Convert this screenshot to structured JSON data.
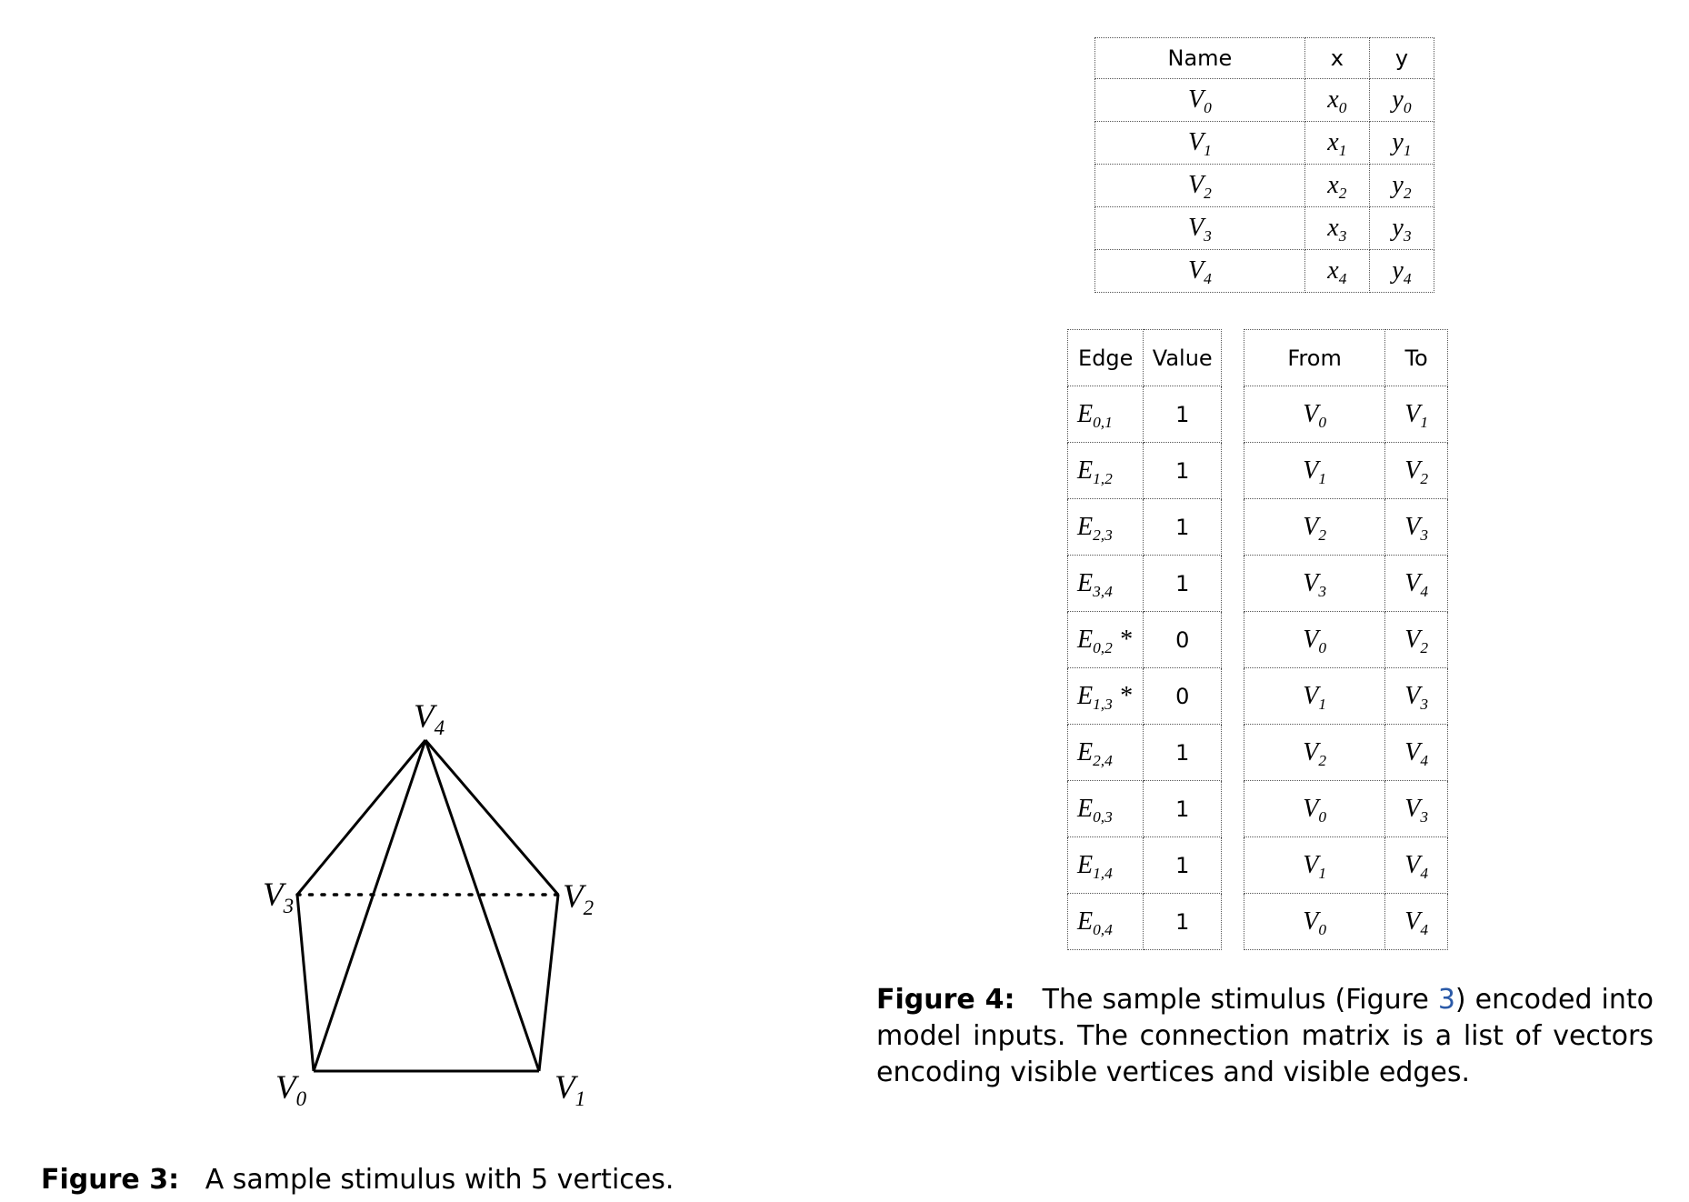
{
  "figure3": {
    "vertices": [
      {
        "name": "V",
        "sub": "0"
      },
      {
        "name": "V",
        "sub": "1"
      },
      {
        "name": "V",
        "sub": "2"
      },
      {
        "name": "V",
        "sub": "3"
      },
      {
        "name": "V",
        "sub": "4"
      }
    ],
    "caption_label": "Figure 3:",
    "caption_text": "A sample stimulus with 5 vertices."
  },
  "vertex_table": {
    "headers": [
      "Name",
      "x",
      "y"
    ],
    "rows": [
      {
        "name": "V",
        "sub": "0",
        "x": "x",
        "xs": "0",
        "y": "y",
        "ys": "0"
      },
      {
        "name": "V",
        "sub": "1",
        "x": "x",
        "xs": "1",
        "y": "y",
        "ys": "1"
      },
      {
        "name": "V",
        "sub": "2",
        "x": "x",
        "xs": "2",
        "y": "y",
        "ys": "2"
      },
      {
        "name": "V",
        "sub": "3",
        "x": "x",
        "xs": "3",
        "y": "y",
        "ys": "3"
      },
      {
        "name": "V",
        "sub": "4",
        "x": "x",
        "xs": "4",
        "y": "y",
        "ys": "4"
      }
    ]
  },
  "edge_table": {
    "headers": [
      "Edge",
      "Value",
      "From",
      "To"
    ],
    "rows": [
      {
        "edge": "E",
        "sub": "0,1",
        "star": "",
        "value": "1",
        "from": "V",
        "fs": "0",
        "to": "V",
        "ts": "1"
      },
      {
        "edge": "E",
        "sub": "1,2",
        "star": "",
        "value": "1",
        "from": "V",
        "fs": "1",
        "to": "V",
        "ts": "2"
      },
      {
        "edge": "E",
        "sub": "2,3",
        "star": "",
        "value": "1",
        "from": "V",
        "fs": "2",
        "to": "V",
        "ts": "3"
      },
      {
        "edge": "E",
        "sub": "3,4",
        "star": "",
        "value": "1",
        "from": "V",
        "fs": "3",
        "to": "V",
        "ts": "4"
      },
      {
        "edge": "E",
        "sub": "0,2",
        "star": "*",
        "value": "0",
        "from": "V",
        "fs": "0",
        "to": "V",
        "ts": "2"
      },
      {
        "edge": "E",
        "sub": "1,3",
        "star": "*",
        "value": "0",
        "from": "V",
        "fs": "1",
        "to": "V",
        "ts": "3"
      },
      {
        "edge": "E",
        "sub": "2,4",
        "star": "",
        "value": "1",
        "from": "V",
        "fs": "2",
        "to": "V",
        "ts": "4"
      },
      {
        "edge": "E",
        "sub": "0,3",
        "star": "",
        "value": "1",
        "from": "V",
        "fs": "0",
        "to": "V",
        "ts": "3"
      },
      {
        "edge": "E",
        "sub": "1,4",
        "star": "",
        "value": "1",
        "from": "V",
        "fs": "1",
        "to": "V",
        "ts": "4"
      },
      {
        "edge": "E",
        "sub": "0,4",
        "star": "",
        "value": "1",
        "from": "V",
        "fs": "0",
        "to": "V",
        "ts": "4"
      }
    ]
  },
  "figure4": {
    "caption_label": "Figure 4:",
    "caption_pre": "The sample stimulus (Figure ",
    "caption_ref": "3",
    "caption_post": ") encoded into model inputs.  The connection matrix is a list of vectors encoding visible vertices and visible edges."
  }
}
